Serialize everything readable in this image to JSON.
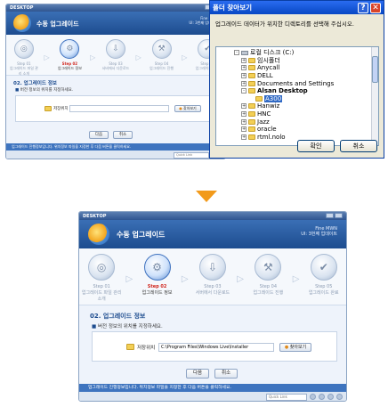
{
  "top_app": {
    "window_title": "DESKTOP",
    "app_title": "수동 업그레이드",
    "version_line1": "Fine MWN",
    "version_line2": "UI: 3번째 업데이트",
    "steps": [
      {
        "label": "Step 01",
        "desc": "업그레이드 파일 관리 소개"
      },
      {
        "label": "Step 02",
        "desc": "업그레이드 정보"
      },
      {
        "label": "Step 03",
        "desc": "서버에서 다운로드"
      },
      {
        "label": "Step 04",
        "desc": "업그레이드 진행"
      },
      {
        "label": "Step 05",
        "desc": "업그레이드 완료"
      }
    ],
    "section_title": "02. 업그레이드 정보",
    "instruction": "버전 정보의 위치를 지정하세요.",
    "path_label": "저장위치",
    "path_value": "",
    "browse_label": "찾아보기",
    "next_label": "다음",
    "cancel_label": "취소",
    "status_text": "업그레이드 진행정보입니다. 위치정보 파일을 지정한 후 다음 버튼을 클릭하세요.",
    "search_placeholder": "Quick Link"
  },
  "dialog": {
    "title": "폴더 찾아보기",
    "help_glyph": "?",
    "close_glyph": "✕",
    "prompt": "업그레이드 데이터가 위치한 디렉토리를 선택해 주십시오.",
    "tree": [
      {
        "label": "로컬 디스크 (C:)",
        "indent": 1,
        "pm": "-",
        "selected": false
      },
      {
        "label": "임시폴더",
        "indent": 2,
        "pm": "+",
        "selected": false
      },
      {
        "label": "Anycall",
        "indent": 2,
        "pm": "+",
        "selected": false
      },
      {
        "label": "DELL",
        "indent": 2,
        "pm": "+",
        "selected": false
      },
      {
        "label": "Documents and Settings",
        "indent": 2,
        "pm": "+",
        "selected": false
      },
      {
        "label": "Alsan Desktop",
        "indent": 2,
        "pm": "-",
        "selected": false
      },
      {
        "label": "A300",
        "indent": 3,
        "pm": "",
        "selected": true
      },
      {
        "label": "Hanwiz",
        "indent": 2,
        "pm": "+",
        "selected": false
      },
      {
        "label": "HNC",
        "indent": 2,
        "pm": "+",
        "selected": false
      },
      {
        "label": "Jazz",
        "indent": 2,
        "pm": "+",
        "selected": false
      },
      {
        "label": "oracle",
        "indent": 2,
        "pm": "+",
        "selected": false
      },
      {
        "label": "rtml.nolo",
        "indent": 2,
        "pm": "+",
        "selected": false
      }
    ],
    "ok_label": "확인",
    "cancel_label": "취소"
  },
  "bottom_app": {
    "window_title": "DESKTOP",
    "app_title": "수동 업그레이드",
    "version_line1": "Fine MWN",
    "version_line2": "UI: 3번째 업데이트",
    "steps": [
      {
        "label": "Step 01",
        "desc": "업그레이드 파일 관리 소개"
      },
      {
        "label": "Step 02",
        "desc": "업그레이드 정보"
      },
      {
        "label": "Step 03",
        "desc": "서버에서 다운로드"
      },
      {
        "label": "Step 04",
        "desc": "업그레이드 진행"
      },
      {
        "label": "Step 05",
        "desc": "업그레이드 완료"
      }
    ],
    "section_title": "02. 업그레이드 정보",
    "instruction": "버전 정보의 위치를 지정하세요.",
    "path_label": "저장위치",
    "path_value": "C:\\Program Files\\Windows Live\\Installer",
    "browse_label": "찾아보기",
    "next_label": "다음",
    "cancel_label": "취소",
    "status_text": "업그레이드 진행정보입니다. 위치정보 파일을 지정한 후 다음 버튼을 클릭하세요.",
    "search_placeholder": "Quick Link"
  },
  "colors": {
    "accent": "#1d4c8f",
    "active_step": "#d0261d",
    "arrow": "#f29a1a",
    "dialog_title": "#0747c4"
  }
}
